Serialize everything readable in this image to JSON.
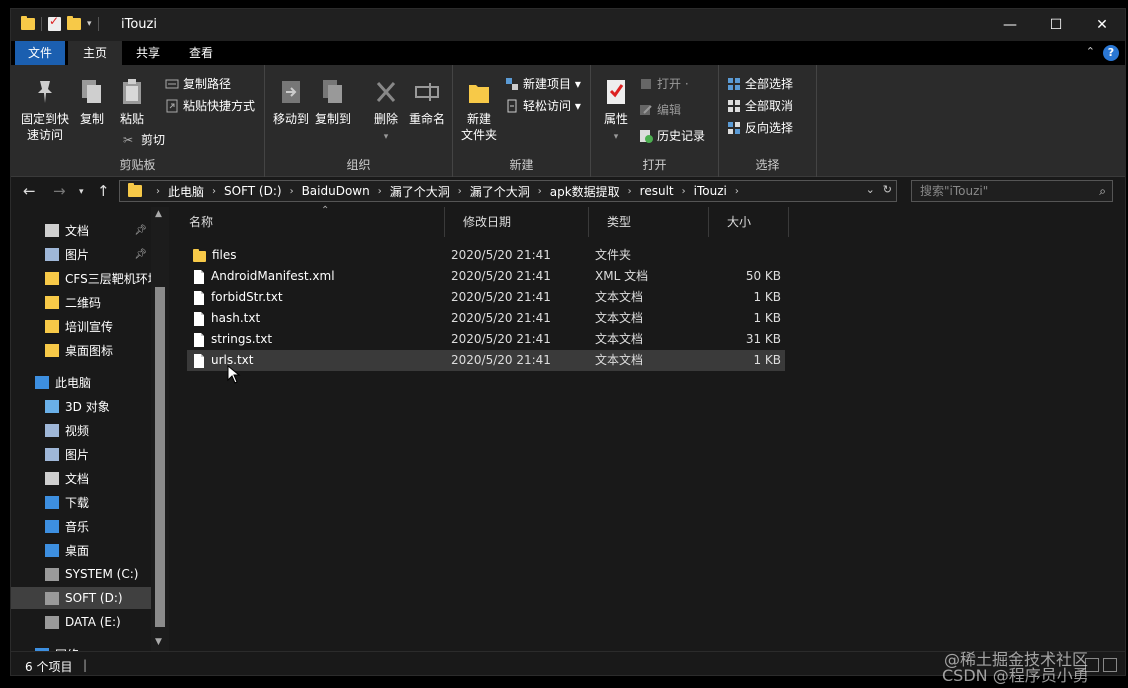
{
  "window": {
    "title": "iTouzi",
    "controls": {
      "minimize": "—",
      "maximize": "☐",
      "close": "✕"
    }
  },
  "ribbon_tabs": {
    "file": "文件",
    "home": "主页",
    "share": "共享",
    "view": "查看"
  },
  "ribbon": {
    "clipboard": {
      "pin_quick_access": [
        "固定到快",
        "速访问"
      ],
      "copy": "复制",
      "paste": "粘贴",
      "copy_path": "复制路径",
      "paste_shortcut": "粘贴快捷方式",
      "cut": "剪切",
      "label": "剪贴板"
    },
    "organize": {
      "move_to": "移动到",
      "copy_to": "复制到",
      "delete": "删除",
      "rename": "重命名",
      "label": "组织"
    },
    "new": {
      "new_folder": [
        "新建",
        "文件夹"
      ],
      "new_item": "新建项目 ▾",
      "easy_access": "轻松访问 ▾",
      "label": "新建"
    },
    "open": {
      "properties": "属性",
      "open": "打开 ·",
      "edit": "编辑",
      "history": "历史记录",
      "label": "打开"
    },
    "select": {
      "select_all": "全部选择",
      "select_none": "全部取消",
      "invert": "反向选择",
      "label": "选择"
    }
  },
  "address": {
    "breadcrumbs": [
      "此电脑",
      "SOFT (D:)",
      "BaiduDown",
      "漏了个大洞",
      "漏了个大洞",
      "apk数据提取",
      "result",
      "iTouzi"
    ],
    "search_placeholder": "搜索\"iTouzi\""
  },
  "nav_pane": {
    "quick": [
      {
        "label": "文档",
        "icon": "documents-icon",
        "pinned": true
      },
      {
        "label": "图片",
        "icon": "pictures-icon",
        "pinned": true
      },
      {
        "label": "CFS三层靶机环境",
        "icon": "folder-icon",
        "pinned": false
      },
      {
        "label": "二维码",
        "icon": "folder-icon",
        "pinned": false
      },
      {
        "label": "培训宣传",
        "icon": "folder-icon",
        "pinned": false
      },
      {
        "label": "桌面图标",
        "icon": "folder-icon",
        "pinned": false
      }
    ],
    "this_pc": "此电脑",
    "pc_items": [
      {
        "label": "3D 对象",
        "icon": "3d-objects-icon"
      },
      {
        "label": "视频",
        "icon": "videos-icon"
      },
      {
        "label": "图片",
        "icon": "pictures-icon"
      },
      {
        "label": "文档",
        "icon": "documents-icon"
      },
      {
        "label": "下载",
        "icon": "downloads-icon"
      },
      {
        "label": "音乐",
        "icon": "music-icon"
      },
      {
        "label": "桌面",
        "icon": "desktop-icon"
      },
      {
        "label": "SYSTEM (C:)",
        "icon": "drive-icon"
      },
      {
        "label": "SOFT (D:)",
        "icon": "drive-icon",
        "selected": true
      },
      {
        "label": "DATA (E:)",
        "icon": "drive-icon"
      }
    ],
    "network": "网络"
  },
  "columns": {
    "name": "名称",
    "date": "修改日期",
    "type": "类型",
    "size": "大小"
  },
  "files": [
    {
      "name": "files",
      "date": "2020/5/20 21:41",
      "type": "文件夹",
      "size": "",
      "kind": "folder"
    },
    {
      "name": "AndroidManifest.xml",
      "date": "2020/5/20 21:41",
      "type": "XML 文档",
      "size": "50 KB",
      "kind": "file"
    },
    {
      "name": "forbidStr.txt",
      "date": "2020/5/20 21:41",
      "type": "文本文档",
      "size": "1 KB",
      "kind": "file"
    },
    {
      "name": "hash.txt",
      "date": "2020/5/20 21:41",
      "type": "文本文档",
      "size": "1 KB",
      "kind": "file"
    },
    {
      "name": "strings.txt",
      "date": "2020/5/20 21:41",
      "type": "文本文档",
      "size": "31 KB",
      "kind": "file"
    },
    {
      "name": "urls.txt",
      "date": "2020/5/20 21:41",
      "type": "文本文档",
      "size": "1 KB",
      "kind": "file",
      "selected": true
    }
  ],
  "status": {
    "count": "6 个项目",
    "sep": "|"
  },
  "watermarks": {
    "juejin": "@稀土掘金技术社区",
    "csdn": "CSDN @程序员小勇"
  },
  "colors": {
    "accent": "#1b5fb0",
    "folder": "#f7c948",
    "background": "#191919",
    "ribbon": "#2b2b2b"
  }
}
